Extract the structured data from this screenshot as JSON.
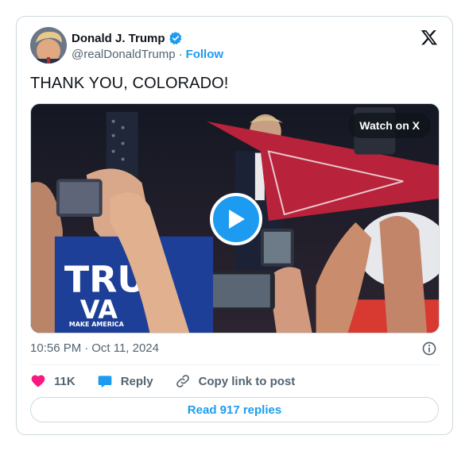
{
  "author": {
    "name": "Donald J. Trump",
    "handle": "@realDonaldTrump",
    "separator": "·",
    "follow_label": "Follow"
  },
  "tweet": {
    "text": "THANK YOU, COLORADO!",
    "time": "10:56 PM",
    "date_separator": "·",
    "date": "Oct 11, 2024"
  },
  "media": {
    "watch_label": "Watch on X",
    "sign_text_line1": "TRU",
    "sign_text_line2": "VA",
    "sign_text_line3": "MAKE AMERICA"
  },
  "actions": {
    "likes": "11K",
    "reply_label": "Reply",
    "copy_label": "Copy link to post"
  },
  "replies_button": "Read 917 replies",
  "icons": {
    "verified": "verified-badge-icon",
    "x": "x-logo-icon",
    "play": "play-icon",
    "info": "info-icon",
    "heart": "heart-icon",
    "reply": "reply-bubble-icon",
    "link": "link-icon"
  },
  "colors": {
    "accent": "#1d9bf0",
    "like": "#f91880",
    "text": "#0f1419",
    "secondary": "#536471",
    "border": "#cfd9de"
  }
}
